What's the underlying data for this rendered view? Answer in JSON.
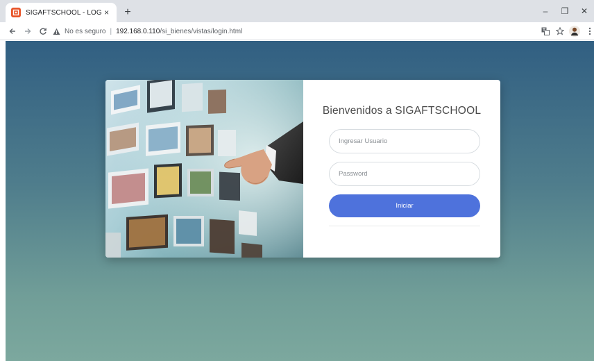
{
  "browser": {
    "tab_title": "SIGAFTSCHOOL - LOGIN",
    "tab_close": "×",
    "new_tab": "+",
    "security_label": "No es seguro",
    "url_host": "192.168.0.110",
    "url_path": "/si_bienes/vistas/login.html",
    "favicon_color": "#e8552a",
    "window_controls": {
      "minimize": "–",
      "restore": "❐",
      "close": "✕"
    }
  },
  "login": {
    "title": "Bienvenidos a SIGAFTSCHOOL",
    "username_placeholder": "Ingresar Usuario",
    "password_placeholder": "Password",
    "submit_label": "Iniciar",
    "button_color": "#4e72dc"
  },
  "icons": {
    "back": "arrow-left-icon",
    "forward": "arrow-right-icon",
    "reload": "reload-icon",
    "security": "warning-triangle-icon",
    "translate": "translate-icon",
    "bookmark": "star-icon",
    "profile": "avatar-icon",
    "menu": "kebab-menu-icon"
  }
}
